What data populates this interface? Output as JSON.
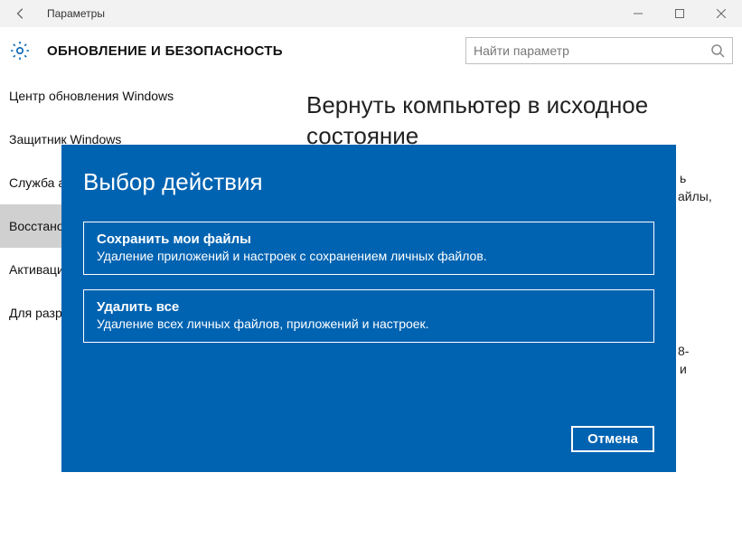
{
  "titlebar": {
    "title": "Параметры"
  },
  "header": {
    "category": "ОБНОВЛЕНИЕ И БЕЗОПАСНОСТЬ"
  },
  "search": {
    "placeholder": "Найти параметр"
  },
  "sidebar": {
    "items": [
      {
        "label": "Центр обновления Windows"
      },
      {
        "label": "Защитник Windows"
      },
      {
        "label": "Служба архивации"
      },
      {
        "label": "Восстановление"
      },
      {
        "label": "Активация"
      },
      {
        "label": "Для разработчиков"
      }
    ],
    "active_index": 3
  },
  "main": {
    "heading": "Вернуть компьютер в исходное состояние",
    "frag1": "ь",
    "frag2": "айлы,",
    "frag3": "8-",
    "frag4": "и"
  },
  "modal": {
    "title": "Выбор действия",
    "options": [
      {
        "title": "Сохранить мои файлы",
        "desc": "Удаление приложений и настроек с сохранением личных файлов."
      },
      {
        "title": "Удалить все",
        "desc": "Удаление всех личных файлов, приложений и настроек."
      }
    ],
    "cancel": "Отмена"
  }
}
